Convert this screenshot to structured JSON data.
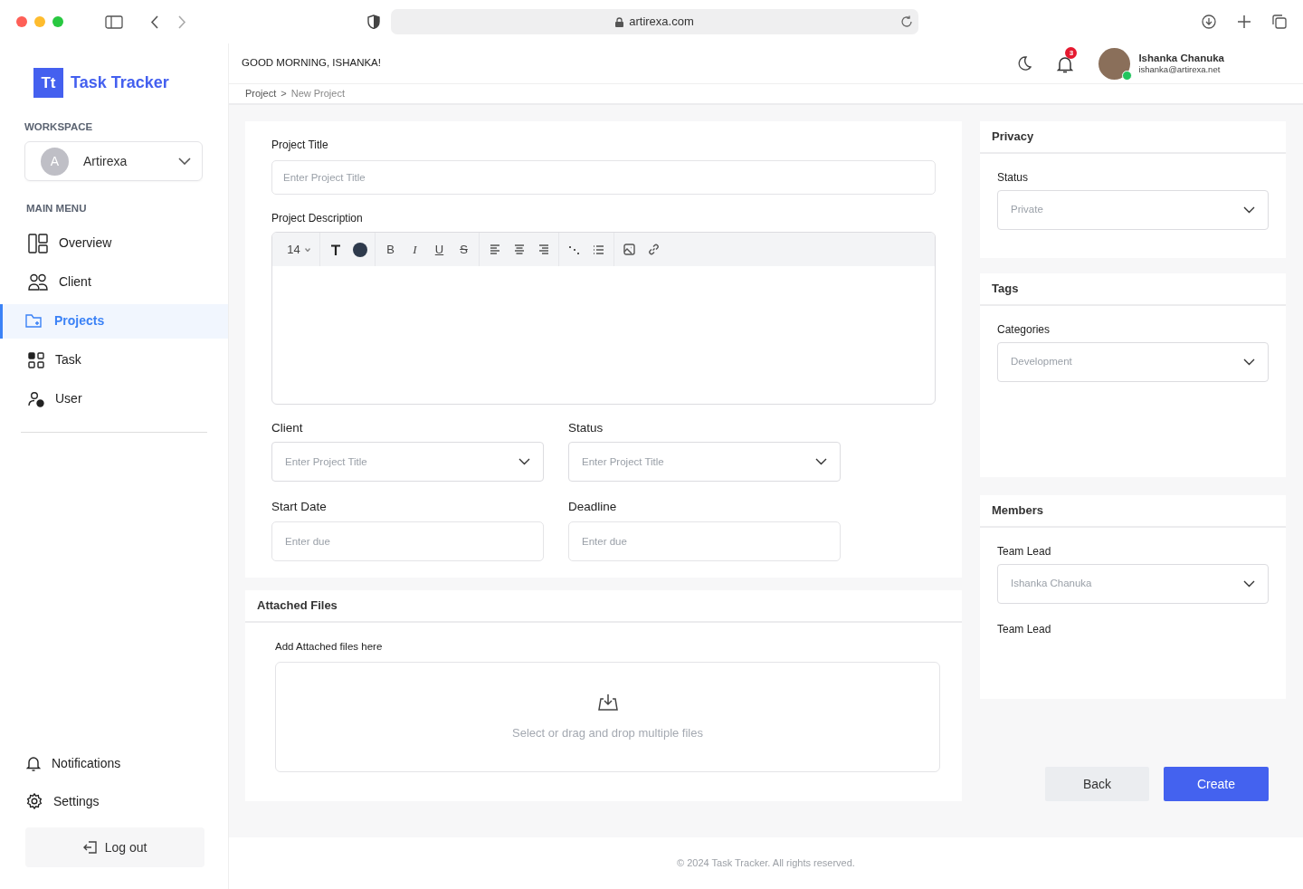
{
  "browser": {
    "url": "artirexa.com"
  },
  "sidebar": {
    "logo_mark": "Tt",
    "app_name": "Task Tracker",
    "workspace_label": "WORKSPACE",
    "workspace": {
      "initial": "A",
      "name": "Artirexa"
    },
    "menu_label": "MAIN MENU",
    "menu": [
      {
        "label": "Overview",
        "selected": false
      },
      {
        "label": "Client",
        "selected": false
      },
      {
        "label": "Projects",
        "selected": true
      },
      {
        "label": "Task",
        "selected": false
      },
      {
        "label": "User",
        "selected": false
      }
    ],
    "bottom_menu": [
      {
        "label": "Notifications"
      },
      {
        "label": "Settings"
      }
    ],
    "logout": "Log out"
  },
  "header": {
    "greeting": "GOOD MORNING, ISHANKA!",
    "notification_count": "3",
    "user": {
      "name": "Ishanka Chanuka",
      "email": "ishanka@artirexa.net",
      "online": true
    }
  },
  "breadcrumb": [
    {
      "label": "Project",
      "current": false
    },
    {
      "label": "New Project",
      "current": true
    }
  ],
  "breadcrumb_separator": ">",
  "project_form": {
    "title_label": "Project Title",
    "title_placeholder": "Enter Project Title",
    "description_label": "Project Description",
    "editor": {
      "font_size": "14",
      "format_buttons": [
        "B",
        "I",
        "U",
        "S"
      ]
    },
    "fields": [
      {
        "label": "Client",
        "kind": "select",
        "placeholder": "Enter Project Title"
      },
      {
        "label": "Status",
        "kind": "select",
        "placeholder": "Enter Project Title"
      },
      {
        "label": "Start Date",
        "kind": "input",
        "placeholder": "Enter due"
      },
      {
        "label": "Deadline",
        "kind": "input",
        "placeholder": "Enter due"
      }
    ]
  },
  "attached_files": {
    "title": "Attached Files",
    "label": "Add Attached files here",
    "dropzone_text": "Select or drag and drop multiple files"
  },
  "privacy": {
    "title": "Privacy",
    "label": "Status",
    "value": "Private"
  },
  "tags": {
    "title": "Tags",
    "label": "Categories",
    "value": "Development"
  },
  "members": {
    "title": "Members",
    "label": "Team Lead",
    "value": "Ishanka Chanuka",
    "second_label": "Team Lead"
  },
  "buttons": [
    {
      "label": "Back",
      "kind": "secondary"
    },
    {
      "label": "Create",
      "kind": "primary"
    }
  ],
  "footer": "© 2024 Task Tracker. All rights reserved."
}
